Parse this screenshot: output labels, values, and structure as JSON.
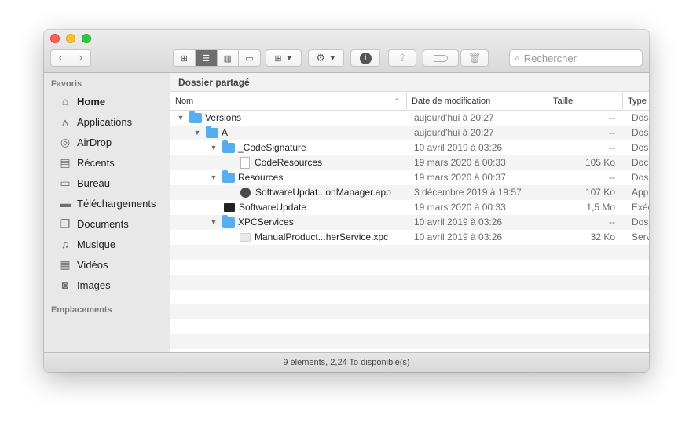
{
  "toolbar": {
    "search_placeholder": "Rechercher"
  },
  "sidebar": {
    "favorites_title": "Favoris",
    "locations_title": "Emplacements",
    "items": [
      {
        "label": "Home",
        "icon": "home-icon"
      },
      {
        "label": "Applications",
        "icon": "applications-icon"
      },
      {
        "label": "AirDrop",
        "icon": "airdrop-icon"
      },
      {
        "label": "Récents",
        "icon": "recents-icon"
      },
      {
        "label": "Bureau",
        "icon": "desktop-icon"
      },
      {
        "label": "Téléchargements",
        "icon": "downloads-icon"
      },
      {
        "label": "Documents",
        "icon": "documents-icon"
      },
      {
        "label": "Musique",
        "icon": "music-icon"
      },
      {
        "label": "Vidéos",
        "icon": "videos-icon"
      },
      {
        "label": "Images",
        "icon": "images-icon"
      }
    ]
  },
  "path": {
    "title": "Dossier partagé"
  },
  "columns": {
    "name": "Nom",
    "date": "Date de modification",
    "size": "Taille",
    "kind": "Type"
  },
  "files": [
    {
      "name": "Versions",
      "date": "aujourd'hui à 20:27",
      "size": "--",
      "kind": "Dossier",
      "type": "folder"
    },
    {
      "name": "A",
      "date": "aujourd'hui à 20:27",
      "size": "--",
      "kind": "Dossier",
      "type": "folder"
    },
    {
      "name": "_CodeSignature",
      "date": "10 avril 2019 à 03:26",
      "size": "--",
      "kind": "Dossier",
      "type": "folder"
    },
    {
      "name": "CodeResources",
      "date": "19 mars 2020 à 00:33",
      "size": "105 Ko",
      "kind": "Document",
      "type": "doc"
    },
    {
      "name": "Resources",
      "date": "19 mars 2020 à 00:37",
      "size": "--",
      "kind": "Dossier",
      "type": "folder"
    },
    {
      "name": "SoftwareUpdat...onManager.app",
      "date": "3 décembre 2019 à 19:57",
      "size": "107 Ko",
      "kind": "Application",
      "type": "app"
    },
    {
      "name": "SoftwareUpdate",
      "date": "19 mars 2020 à 00:33",
      "size": "1,5 Mo",
      "kind": "Exécutable",
      "type": "exec"
    },
    {
      "name": "XPCServices",
      "date": "10 avril 2019 à 03:26",
      "size": "--",
      "kind": "Dossier",
      "type": "folder"
    },
    {
      "name": "ManualProduct...herService.xpc",
      "date": "10 avril 2019 à 03:26",
      "size": "32 Ko",
      "kind": "Service",
      "type": "xpc"
    }
  ],
  "status": {
    "text": "9 éléments, 2,24 To disponible(s)"
  },
  "colors": {
    "folder": "#54aef0",
    "close": "#ff5f57",
    "minimize": "#febc2e",
    "maximize": "#28c840"
  }
}
